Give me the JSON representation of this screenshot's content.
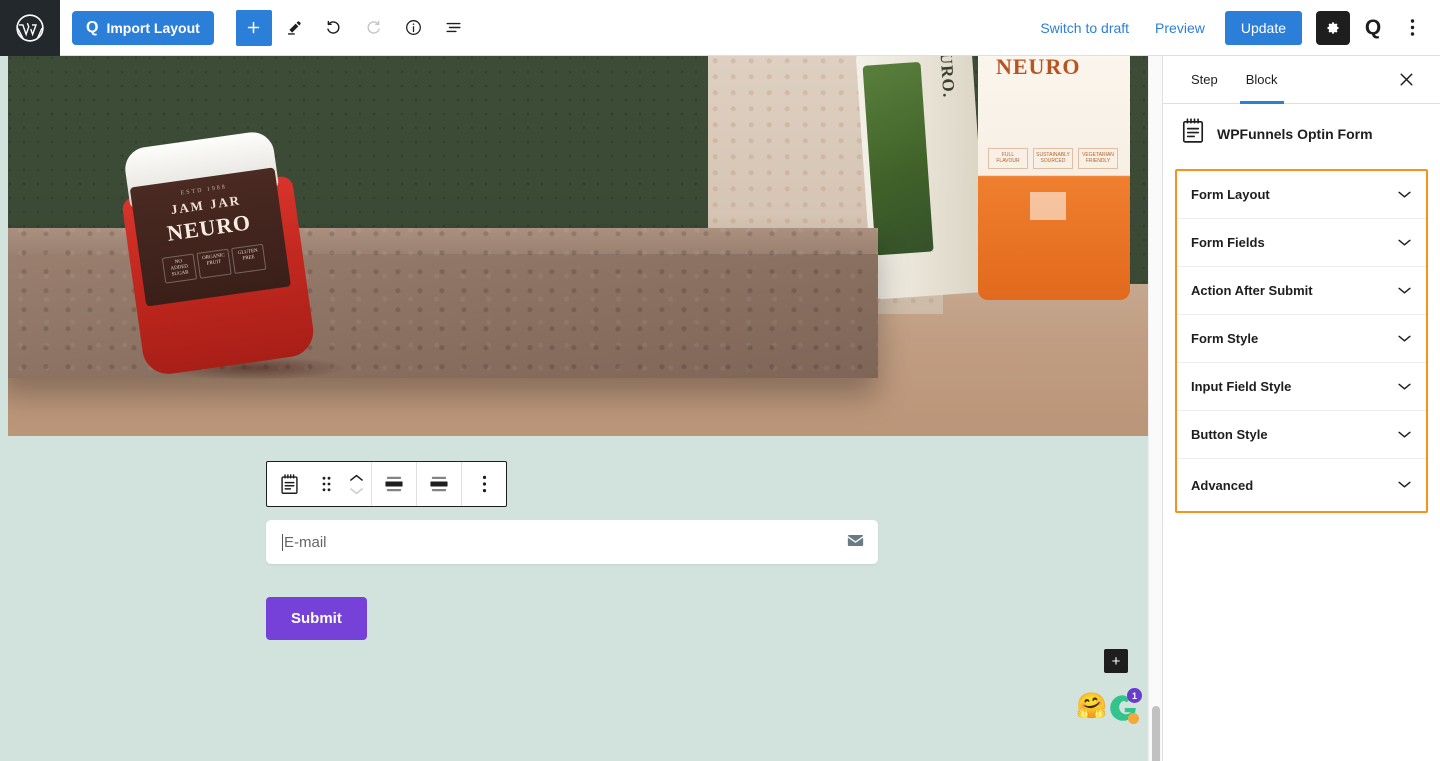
{
  "topbar": {
    "wp_logo_icon": "wordpress-logo-icon",
    "import_button": {
      "label": "Import Layout",
      "glyph": "Q",
      "color": "#2c7fd9"
    },
    "tools": [
      {
        "name": "block-inserter",
        "icon": "plus-icon",
        "active": true
      },
      {
        "name": "tools-edit",
        "icon": "pencil-icon",
        "active": false
      },
      {
        "name": "undo",
        "icon": "undo-arrow-icon",
        "disabled": false
      },
      {
        "name": "redo",
        "icon": "redo-arrow-icon",
        "disabled": true
      },
      {
        "name": "details",
        "icon": "info-circle-icon",
        "disabled": false
      },
      {
        "name": "list-view",
        "icon": "list-view-icon",
        "disabled": false
      }
    ],
    "switch_to_draft": "Switch to draft",
    "preview": "Preview",
    "update": "Update",
    "settings_icon": "gear-icon",
    "wpfunnels_icon": "q-logo-icon",
    "more_icon": "vertical-ellipsis-icon"
  },
  "canvas": {
    "background_color": "#d2e3dd",
    "hero_image": {
      "alt": "NEURO jam jar product photo on stone plinth",
      "background_color": "#3a4a35",
      "jar_label": {
        "top_tiny": "ESTD 1988",
        "line1": "JAM JAR",
        "line2": "NEURO",
        "chips": [
          "NO ADDED SUGAR",
          "ORGANIC FRUIT",
          "GLUTEN FREE"
        ]
      },
      "right_jar_green_text": "NEURO.",
      "right_jar_orange_text": "NEURO",
      "right_jar_chips": [
        "FULL FLAVOUR",
        "SUSTAINABLY SOURCED",
        "VEGETARIAN FRIENDLY"
      ]
    },
    "block_toolbar": {
      "block_icon": "optin-form-block-icon",
      "drag_icon": "drag-handle-icon",
      "move_up_icon": "chevron-up-icon",
      "move_down_icon": "chevron-down-icon",
      "align_icon": "align-center-icon",
      "justify_icon": "justify-center-icon",
      "options_icon": "vertical-ellipsis-icon"
    },
    "optin_form": {
      "email_placeholder": "E-mail",
      "email_value": "",
      "email_icon": "envelope-icon",
      "submit_label": "Submit",
      "submit_color": "#7541d8"
    },
    "add_block_label": "+",
    "emoji_icon": "hugging-face-emoji",
    "grammarly": {
      "icon": "grammarly-g-icon",
      "badge_count": "1",
      "badge_color": "#6a3bd1"
    }
  },
  "sidebar": {
    "tabs": [
      {
        "label": "Step",
        "active": false
      },
      {
        "label": "Block",
        "active": true
      }
    ],
    "close_icon": "close-icon",
    "block": {
      "icon": "optin-form-block-icon",
      "name": "WPFunnels Optin Form"
    },
    "highlight_color": "#f7921e",
    "panels": [
      {
        "label": "Form Layout",
        "icon": "chevron-down-icon"
      },
      {
        "label": "Form Fields",
        "icon": "chevron-down-icon"
      },
      {
        "label": "Action After Submit",
        "icon": "chevron-down-icon"
      },
      {
        "label": "Form Style",
        "icon": "chevron-down-icon"
      },
      {
        "label": "Input Field Style",
        "icon": "chevron-down-icon"
      },
      {
        "label": "Button Style",
        "icon": "chevron-down-icon"
      },
      {
        "label": "Advanced",
        "icon": "chevron-down-icon"
      }
    ]
  }
}
